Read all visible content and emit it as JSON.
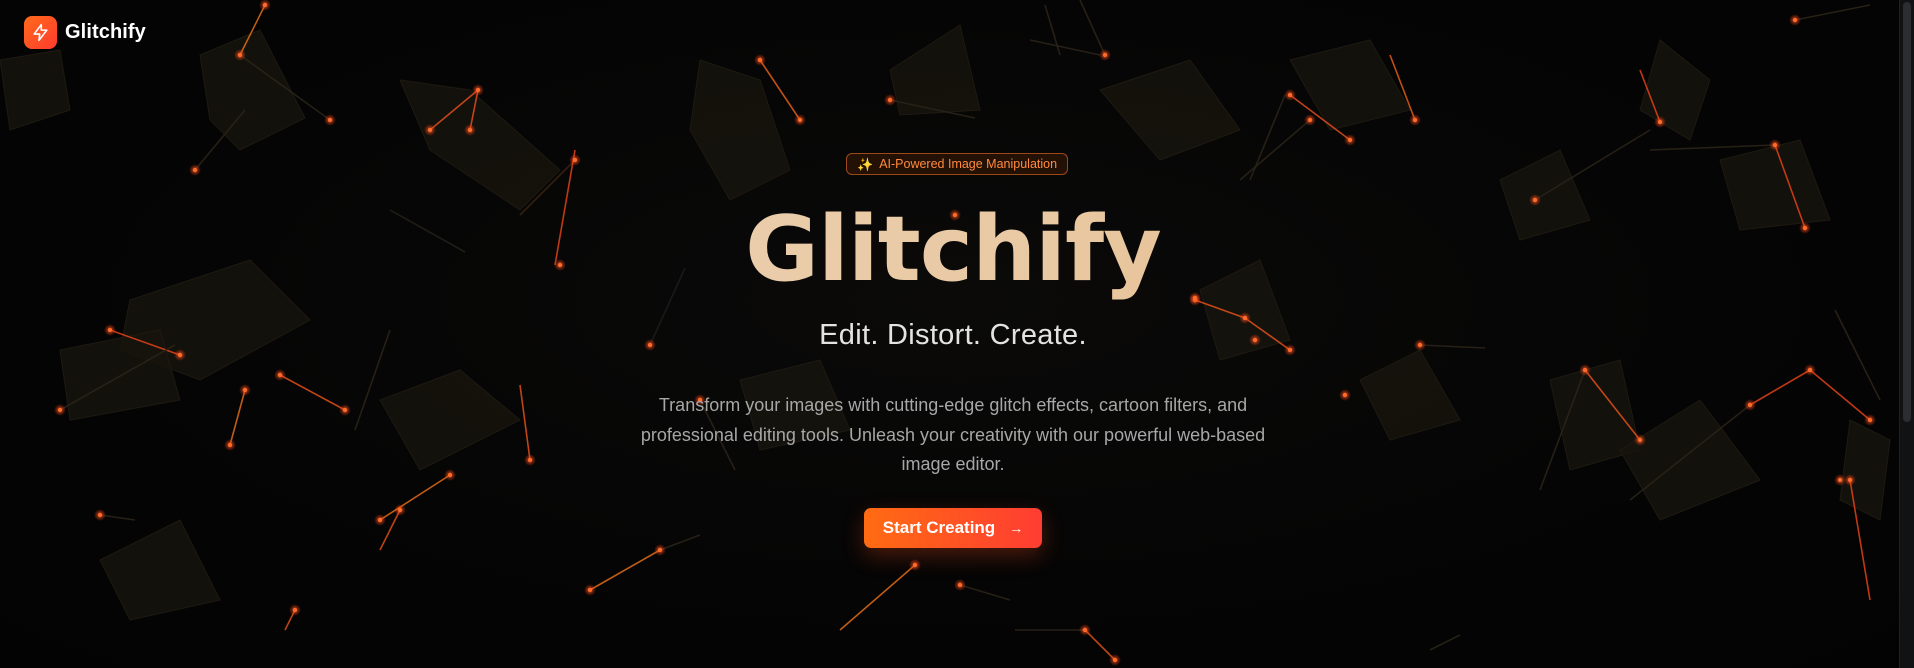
{
  "header": {
    "brand_name": "Glitchify",
    "logo_icon": "lightning-bolt-icon"
  },
  "hero": {
    "badge": {
      "icon": "sparkles-icon",
      "text": "AI-Powered Image Manipulation"
    },
    "title": "Glitchify",
    "subtitle": "Edit. Distort. Create.",
    "description": "Transform your images with cutting-edge glitch effects, cartoon filters, and professional editing tools. Unleash your creativity with our powerful web-based image editor.",
    "cta": {
      "label": "Start Creating",
      "icon": "arrow-right-icon"
    }
  },
  "theme": {
    "background": "#050505",
    "accent_orange": "#ff6b12",
    "accent_red": "#ff3d33",
    "title_gradient": [
      "#ecd6bd",
      "#e3a262"
    ],
    "badge_text": "#ff8a3d"
  }
}
